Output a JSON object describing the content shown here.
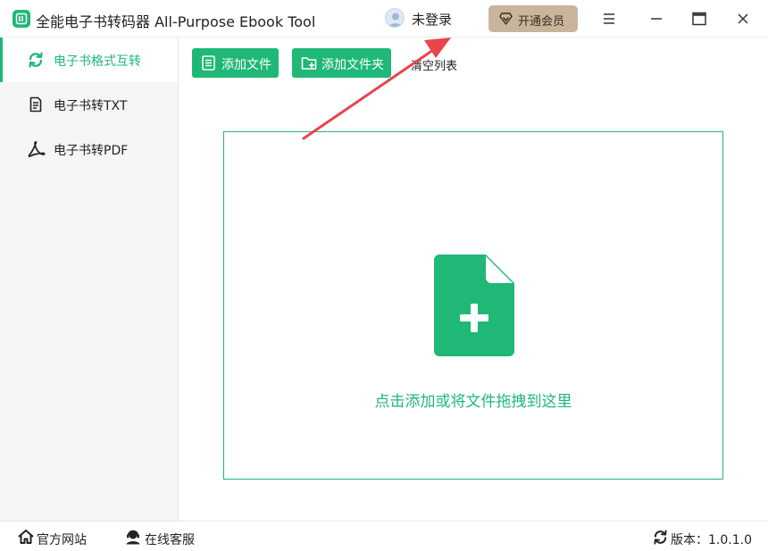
{
  "window": {
    "title": "全能电子书转码器 All-Purpose Ebook Tool",
    "user_status": "未登录",
    "vip_button": "开通会员",
    "accent_color": "#1fb877",
    "vip_color": "#c9b59c"
  },
  "sidebar": {
    "items": [
      {
        "label": "电子书格式互转",
        "icon": "refresh-icon",
        "active": true
      },
      {
        "label": "电子书转TXT",
        "icon": "document-icon",
        "active": false
      },
      {
        "label": "电子书转PDF",
        "icon": "pdf-icon",
        "active": false
      }
    ]
  },
  "toolbar": {
    "add_file": "添加文件",
    "add_folder": "添加文件夹",
    "clear_list": "清空列表"
  },
  "dropzone": {
    "text": "点击添加或将文件拖拽到这里",
    "icon": "file-plus-icon"
  },
  "footer": {
    "website": "官方网站",
    "service": "在线客服",
    "version": "版本：1.0.1.0"
  },
  "annotation": {
    "icon": "red-arrow",
    "color": "#e8454e"
  }
}
